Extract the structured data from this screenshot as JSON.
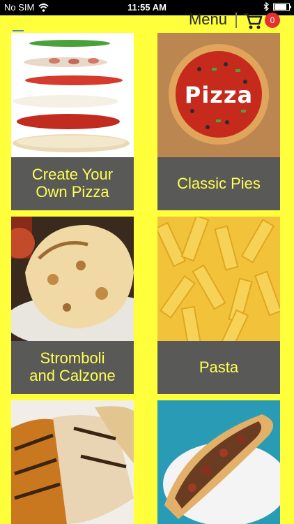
{
  "status_bar": {
    "carrier": "No SIM",
    "time": "11:55 AM"
  },
  "header": {
    "menu_label": "Menu",
    "cart_count": "0"
  },
  "tiles": [
    {
      "label": "Create Your\nOwn Pizza"
    },
    {
      "label": "Classic Pies"
    },
    {
      "label": "Stromboli\nand Calzone"
    },
    {
      "label": "Pasta"
    },
    {
      "label": ""
    },
    {
      "label": ""
    }
  ],
  "pizza_text": "Pizza",
  "colors": {
    "background": "#ffff3c",
    "label_bg": "#595a57",
    "label_text": "#ffff55",
    "badge": "#e53030"
  }
}
